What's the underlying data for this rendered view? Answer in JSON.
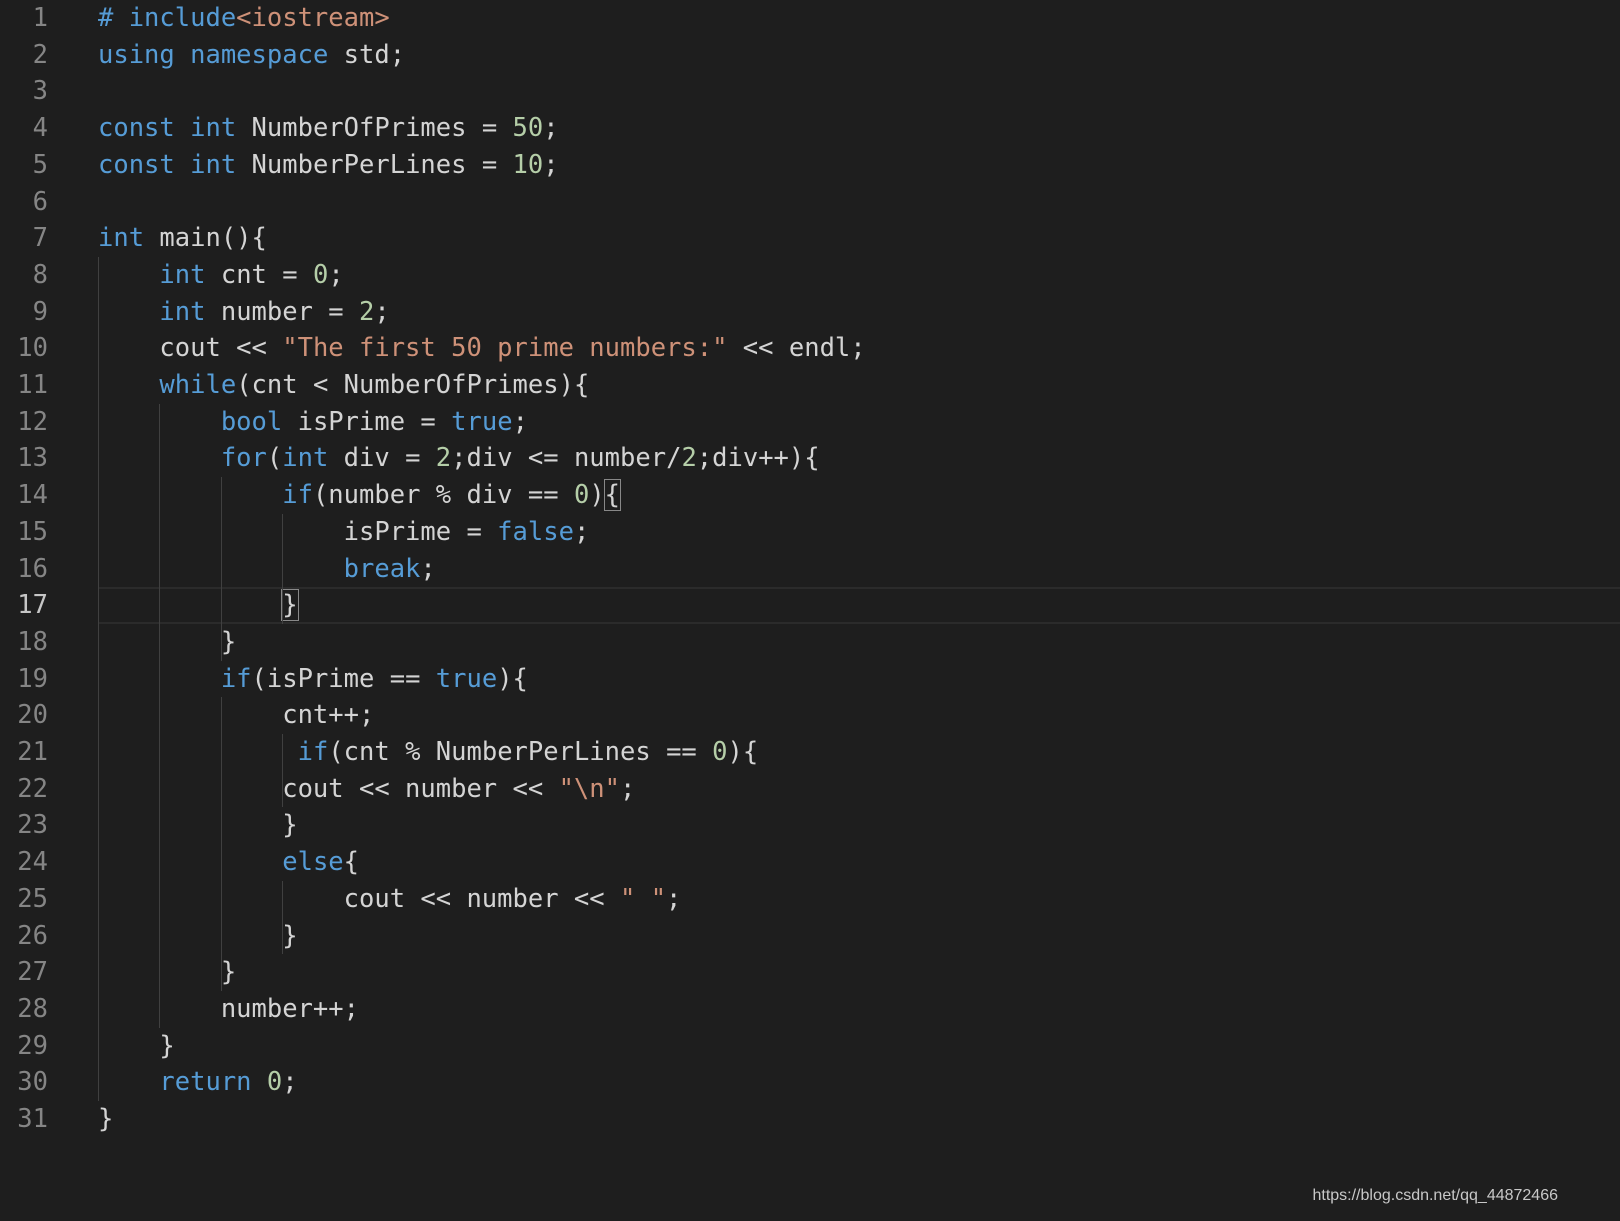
{
  "editor": {
    "active_line": 17,
    "lines": [
      {
        "n": "1",
        "tokens": [
          [
            "inc",
            "# include"
          ],
          [
            "str",
            "<iostream>"
          ]
        ]
      },
      {
        "n": "2",
        "tokens": [
          [
            "kw",
            "using"
          ],
          [
            "txt",
            " "
          ],
          [
            "kw",
            "namespace"
          ],
          [
            "txt",
            " std;"
          ]
        ]
      },
      {
        "n": "3",
        "tokens": []
      },
      {
        "n": "4",
        "tokens": [
          [
            "kw",
            "const"
          ],
          [
            "txt",
            " "
          ],
          [
            "kw",
            "int"
          ],
          [
            "txt",
            " NumberOfPrimes = "
          ],
          [
            "num",
            "50"
          ],
          [
            "txt",
            ";"
          ]
        ]
      },
      {
        "n": "5",
        "tokens": [
          [
            "kw",
            "const"
          ],
          [
            "txt",
            " "
          ],
          [
            "kw",
            "int"
          ],
          [
            "txt",
            " NumberPerLines = "
          ],
          [
            "num",
            "10"
          ],
          [
            "txt",
            ";"
          ]
        ]
      },
      {
        "n": "6",
        "tokens": []
      },
      {
        "n": "7",
        "tokens": [
          [
            "kw",
            "int"
          ],
          [
            "txt",
            " main(){"
          ]
        ]
      },
      {
        "n": "8",
        "tokens": [
          [
            "txt",
            "    "
          ],
          [
            "kw",
            "int"
          ],
          [
            "txt",
            " cnt = "
          ],
          [
            "num",
            "0"
          ],
          [
            "txt",
            ";"
          ]
        ]
      },
      {
        "n": "9",
        "tokens": [
          [
            "txt",
            "    "
          ],
          [
            "kw",
            "int"
          ],
          [
            "txt",
            " number = "
          ],
          [
            "num",
            "2"
          ],
          [
            "txt",
            ";"
          ]
        ]
      },
      {
        "n": "10",
        "tokens": [
          [
            "txt",
            "    cout << "
          ],
          [
            "str",
            "\"The first 50 prime numbers:\""
          ],
          [
            "txt",
            " << endl;"
          ]
        ]
      },
      {
        "n": "11",
        "tokens": [
          [
            "txt",
            "    "
          ],
          [
            "ctl",
            "while"
          ],
          [
            "txt",
            "(cnt < NumberOfPrimes){"
          ]
        ]
      },
      {
        "n": "12",
        "tokens": [
          [
            "txt",
            "        "
          ],
          [
            "kw",
            "bool"
          ],
          [
            "txt",
            " isPrime = "
          ],
          [
            "kw",
            "true"
          ],
          [
            "txt",
            ";"
          ]
        ]
      },
      {
        "n": "13",
        "tokens": [
          [
            "txt",
            "        "
          ],
          [
            "ctl",
            "for"
          ],
          [
            "txt",
            "("
          ],
          [
            "kw",
            "int"
          ],
          [
            "txt",
            " div = "
          ],
          [
            "num",
            "2"
          ],
          [
            "txt",
            ";div <= number/"
          ],
          [
            "num",
            "2"
          ],
          [
            "txt",
            ";div++){"
          ]
        ]
      },
      {
        "n": "14",
        "tokens": [
          [
            "txt",
            "            "
          ],
          [
            "ctl",
            "if"
          ],
          [
            "txt",
            "(number % div == "
          ],
          [
            "num",
            "0"
          ],
          [
            "txt",
            ")"
          ],
          [
            "box",
            "{"
          ]
        ]
      },
      {
        "n": "15",
        "tokens": [
          [
            "txt",
            "                isPrime = "
          ],
          [
            "kw",
            "false"
          ],
          [
            "txt",
            ";"
          ]
        ]
      },
      {
        "n": "16",
        "tokens": [
          [
            "txt",
            "                "
          ],
          [
            "ctl",
            "break"
          ],
          [
            "txt",
            ";"
          ]
        ]
      },
      {
        "n": "17",
        "tokens": [
          [
            "txt",
            "            "
          ],
          [
            "box",
            "}"
          ]
        ]
      },
      {
        "n": "18",
        "tokens": [
          [
            "txt",
            "        }"
          ]
        ]
      },
      {
        "n": "19",
        "tokens": [
          [
            "txt",
            "        "
          ],
          [
            "ctl",
            "if"
          ],
          [
            "txt",
            "(isPrime == "
          ],
          [
            "kw",
            "true"
          ],
          [
            "txt",
            "){"
          ]
        ]
      },
      {
        "n": "20",
        "tokens": [
          [
            "txt",
            "            cnt++;"
          ]
        ]
      },
      {
        "n": "21",
        "tokens": [
          [
            "txt",
            "             "
          ],
          [
            "ctl",
            "if"
          ],
          [
            "txt",
            "(cnt % NumberPerLines == "
          ],
          [
            "num",
            "0"
          ],
          [
            "txt",
            "){"
          ]
        ]
      },
      {
        "n": "22",
        "tokens": [
          [
            "txt",
            "            cout << number << "
          ],
          [
            "str",
            "\"\\n\""
          ],
          [
            "txt",
            ";"
          ]
        ]
      },
      {
        "n": "23",
        "tokens": [
          [
            "txt",
            "            }"
          ]
        ]
      },
      {
        "n": "24",
        "tokens": [
          [
            "txt",
            "            "
          ],
          [
            "ctl",
            "else"
          ],
          [
            "txt",
            "{"
          ]
        ]
      },
      {
        "n": "25",
        "tokens": [
          [
            "txt",
            "                cout << number << "
          ],
          [
            "str",
            "\" \""
          ],
          [
            "txt",
            ";"
          ]
        ]
      },
      {
        "n": "26",
        "tokens": [
          [
            "txt",
            "            }"
          ]
        ]
      },
      {
        "n": "27",
        "tokens": [
          [
            "txt",
            "        }"
          ]
        ]
      },
      {
        "n": "28",
        "tokens": [
          [
            "txt",
            "        number++;"
          ]
        ]
      },
      {
        "n": "29",
        "tokens": [
          [
            "txt",
            "    }"
          ]
        ]
      },
      {
        "n": "30",
        "tokens": [
          [
            "txt",
            "    "
          ],
          [
            "ctl",
            "return"
          ],
          [
            "txt",
            " "
          ],
          [
            "num",
            "0"
          ],
          [
            "txt",
            ";"
          ]
        ]
      },
      {
        "n": "31",
        "tokens": [
          [
            "txt",
            "}"
          ]
        ]
      }
    ]
  },
  "watermark": "https://blog.csdn.net/qq_44872466",
  "colors": {
    "background": "#1e1e1e",
    "keyword": "#569cd6",
    "control": "#569cd6",
    "number": "#b5cea8",
    "string": "#ce9178",
    "text": "#d4d4d4",
    "line_number": "#858585"
  }
}
